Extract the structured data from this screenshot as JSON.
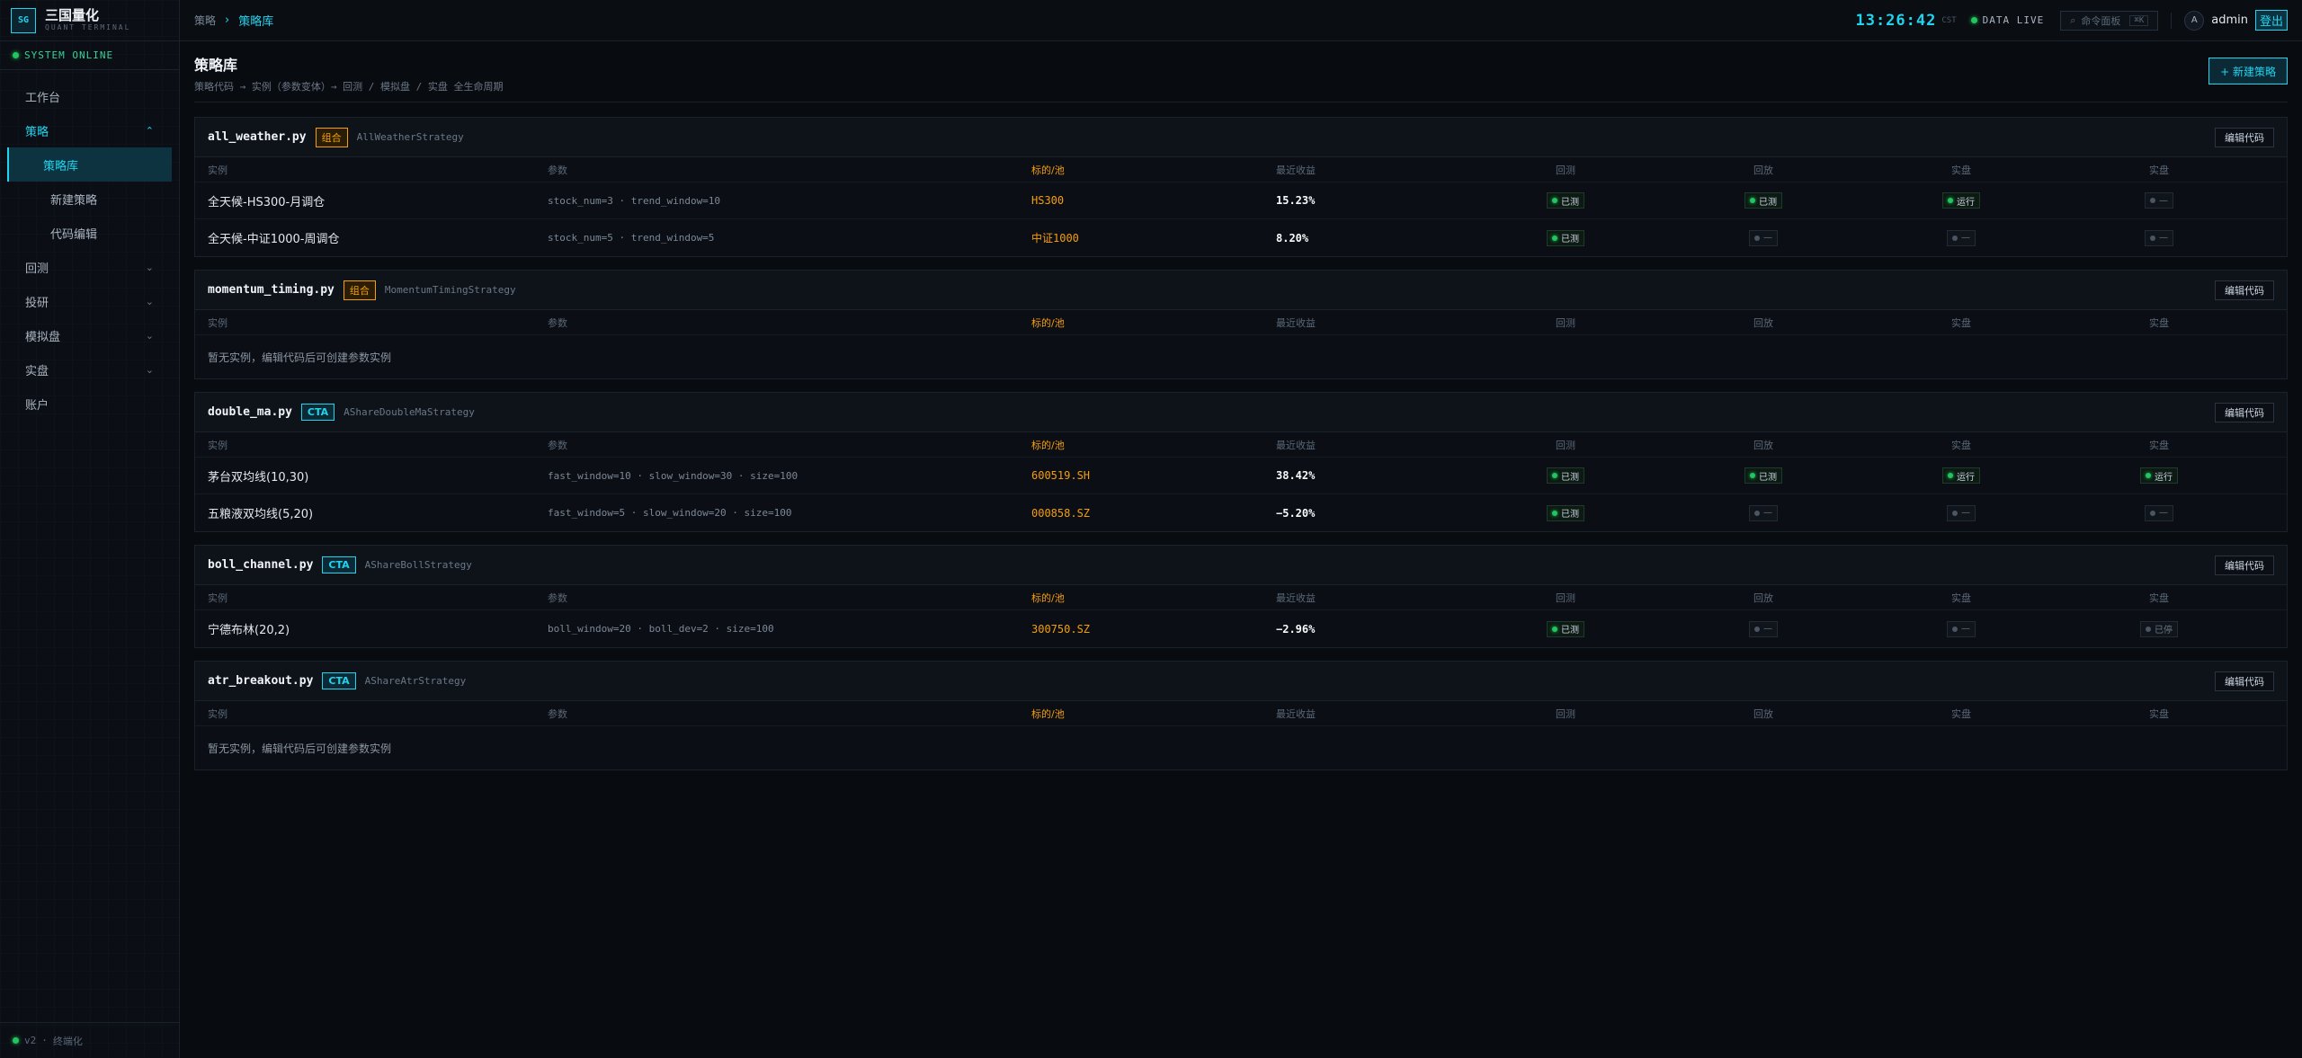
{
  "brand": {
    "logo": "SG",
    "title": "三国量化",
    "subtitle": "QUANT TERMINAL"
  },
  "system_status": "SYSTEM ONLINE",
  "nav": {
    "workbench": "工作台",
    "strategy": "策略",
    "strategy_sub": [
      "策略库",
      "新建策略",
      "代码编辑"
    ],
    "backtest": "回测",
    "research": "投研",
    "paper": "模拟盘",
    "live": "实盘",
    "account": "账户"
  },
  "footer": {
    "version": "v2",
    "sep": "·",
    "label": "终端化"
  },
  "topbar": {
    "crumb_parent": "策略",
    "crumb_current": "策略库",
    "clock": "13:26:42",
    "tz": "CST",
    "data_live": "DATA LIVE",
    "cmd_label": "命令面板",
    "cmd_kbd": "⌘K",
    "avatar": "A",
    "user": "admin",
    "logout": "登出"
  },
  "page": {
    "title": "策略库",
    "subtitle": "策略代码 → 实例（参数变体）→ 回测 / 模拟盘 / 实盘 全生命周期",
    "new_button": "+ 新建策略"
  },
  "columns": [
    "实例",
    "参数",
    "标的/池",
    "最近收益",
    "回测",
    "回放",
    "实盘",
    "实盘"
  ],
  "edit_label": "编辑代码",
  "empty_text": "暂无实例，编辑代码后可创建参数实例",
  "strategies": [
    {
      "file": "all_weather.py",
      "tag": "组合",
      "tag_type": "combo",
      "cls": "AllWeatherStrategy",
      "instances": [
        {
          "name": "全天候-HS300-月调仓",
          "params": "stock_num=3 · trend_window=10",
          "target": "HS300",
          "ret": "15.23%",
          "s": [
            {
              "t": "已测",
              "on": true
            },
            {
              "t": "已测",
              "on": true
            },
            {
              "t": "运行",
              "on": true
            },
            {
              "t": "—",
              "on": false
            }
          ]
        },
        {
          "name": "全天候-中证1000-周调仓",
          "params": "stock_num=5 · trend_window=5",
          "target": "中证1000",
          "ret": "8.20%",
          "s": [
            {
              "t": "已测",
              "on": true
            },
            {
              "t": "—",
              "on": false
            },
            {
              "t": "—",
              "on": false
            },
            {
              "t": "—",
              "on": false
            }
          ]
        }
      ]
    },
    {
      "file": "momentum_timing.py",
      "tag": "组合",
      "tag_type": "combo",
      "cls": "MomentumTimingStrategy",
      "instances": []
    },
    {
      "file": "double_ma.py",
      "tag": "CTA",
      "tag_type": "cta",
      "cls": "AShareDoubleMaStrategy",
      "instances": [
        {
          "name": "茅台双均线(10,30)",
          "params": "fast_window=10 · slow_window=30 · size=100",
          "target": "600519.SH",
          "ret": "38.42%",
          "s": [
            {
              "t": "已测",
              "on": true
            },
            {
              "t": "已测",
              "on": true
            },
            {
              "t": "运行",
              "on": true
            },
            {
              "t": "运行",
              "on": true
            }
          ]
        },
        {
          "name": "五粮液双均线(5,20)",
          "params": "fast_window=5 · slow_window=20 · size=100",
          "target": "000858.SZ",
          "ret": "−5.20%",
          "s": [
            {
              "t": "已测",
              "on": true
            },
            {
              "t": "—",
              "on": false
            },
            {
              "t": "—",
              "on": false
            },
            {
              "t": "—",
              "on": false
            }
          ]
        }
      ]
    },
    {
      "file": "boll_channel.py",
      "tag": "CTA",
      "tag_type": "cta",
      "cls": "AShareBollStrategy",
      "instances": [
        {
          "name": "宁德布林(20,2)",
          "params": "boll_window=20 · boll_dev=2 · size=100",
          "target": "300750.SZ",
          "ret": "−2.96%",
          "s": [
            {
              "t": "已测",
              "on": true
            },
            {
              "t": "—",
              "on": false
            },
            {
              "t": "—",
              "on": false
            },
            {
              "t": "已停",
              "on": false
            }
          ]
        }
      ]
    },
    {
      "file": "atr_breakout.py",
      "tag": "CTA",
      "tag_type": "cta",
      "cls": "AShareAtrStrategy",
      "instances": []
    }
  ]
}
